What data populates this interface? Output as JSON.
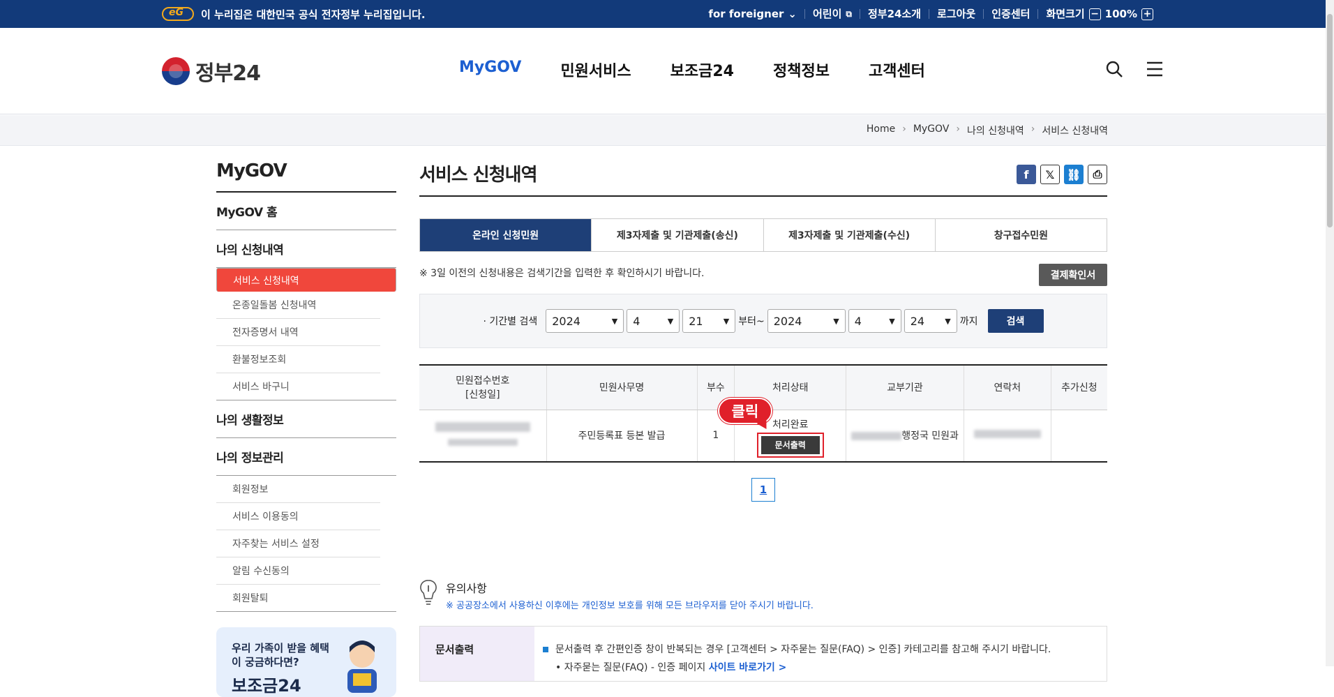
{
  "topbar": {
    "notice": "이 누리집은 대한민국 공식 전자정부 누리집입니다.",
    "links": [
      "for foreigner",
      "어린이",
      "정부24소개",
      "로그아웃",
      "인증센터",
      "화면크기"
    ],
    "zoom": "100%"
  },
  "logo": {
    "text": "정부24"
  },
  "gnb": [
    "MyGOV",
    "민원서비스",
    "보조금24",
    "정책정보",
    "고객센터"
  ],
  "breadcrumb": [
    "Home",
    "MyGOV",
    "나의 신청내역",
    "서비스 신청내역"
  ],
  "lnb": {
    "title": "MyGOV",
    "home": "MyGOV 홈",
    "apply": "나의 신청내역",
    "apply_items": [
      "서비스 신청내역",
      "온종일돌봄 신청내역",
      "전자증명서 내역",
      "환불정보조회",
      "서비스 바구니"
    ],
    "life": "나의 생활정보",
    "info": "나의 정보관리",
    "info_items": [
      "회원정보",
      "서비스 이용동의",
      "자주찾는 서비스 설정",
      "알림 수신동의",
      "회원탈퇴"
    ],
    "banner_text": "우리 가족이 받을 혜택이 궁금하다면?",
    "banner_bold": "보조금24"
  },
  "main": {
    "title": "서비스 신청내역",
    "tabs": [
      "온라인 신청민원",
      "제3자제출 및 기관제출(송신)",
      "제3자제출 및 기관제출(수신)",
      "창구접수민원"
    ],
    "note": "※ 3일 이전의 신청내용은 검색기간을 입력한 후 확인하시기 바랍니다.",
    "confirm_btn": "결제확인서",
    "search": {
      "label": "· 기간별 검색",
      "from_year": "2024",
      "from_month": "4",
      "from_day": "21",
      "from_word": "부터~",
      "to_year": "2024",
      "to_month": "4",
      "to_day": "24",
      "to_word": "까지",
      "button": "검색"
    },
    "table": {
      "headers": [
        "민원접수번호",
        "[신청일]",
        "민원사무명",
        "부수",
        "처리상태",
        "교부기관",
        "연락처",
        "추가신청"
      ],
      "row": {
        "name": "주민등록표 등본 발급",
        "count": "1",
        "status": "처리완료",
        "print_btn": "문서출력",
        "org_suffix": "행정국 민원과"
      }
    },
    "callout": "클릭",
    "page": "1",
    "caution_title": "유의사항",
    "caution_desc": "※ 공공장소에서 사용하신 이후에는 개인정보 보호를 위해 모든 브라우저를 닫아 주시기 바랍니다.",
    "info_label": "문서출력",
    "info_text": "문서출력 후 간편인증 창이 반복되는 경우 [고객센터 > 자주묻는 질문(FAQ) > 인증] 카테고리를 참고해 주시기 바랍니다.",
    "info_sub": "• 자주묻는 질문(FAQ) - 인증 페이지",
    "info_link": "사이트 바로가기 >"
  },
  "colors": {
    "navy": "#123a7a",
    "accent": "#1c5fd1",
    "active_menu": "#f0473c",
    "highlight": "#e0202a"
  }
}
